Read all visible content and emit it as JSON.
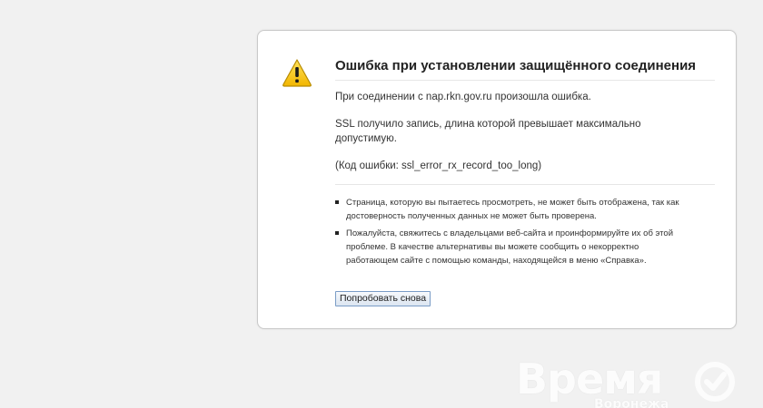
{
  "error": {
    "title": "Ошибка при установлении защищённого соединения",
    "connection_message": "При соединении с nap.rkn.gov.ru произошла ошибка.",
    "ssl_message": "SSL получило запись, длина которой превышает максимально допустимую.",
    "error_code": "(Код ошибки: ssl_error_rx_record_too_long)",
    "bullets": [
      "Страница, которую вы пытаетесь просмотреть, не может быть отображена, так как достоверность полученных данных не может быть проверена.",
      "Пожалуйста, свяжитесь с владельцами веб-сайта и проинформируйте их об этой проблеме. В качестве альтернативы вы можете сообщить о некорректно работающем сайте с помощью команды, находящейся в меню «Справка»."
    ],
    "retry_label": "Попробовать снова",
    "icon": "warning-triangle-icon"
  },
  "watermark": {
    "brand": "Время",
    "subtitle": "Воронежа",
    "icon": "check-circle-icon"
  },
  "colors": {
    "background": "#f1f1f1",
    "box_border": "#c9c9c9",
    "warning_yellow": "#f5c400",
    "button_border": "#7a9cc6"
  }
}
